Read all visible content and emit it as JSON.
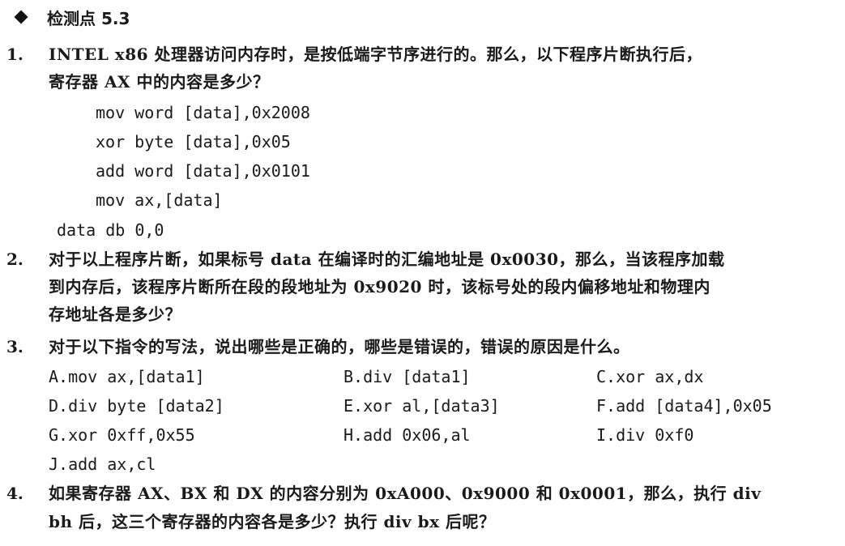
{
  "section": {
    "title": "检测点 5.3"
  },
  "questions": [
    {
      "number": "1.",
      "lines": [
        "INTEL x86 处理器访问内存时，是按低端字节序进行的。那么，以下程序片断执行后，",
        "寄存器 AX 中的内容是多少？"
      ],
      "code": [
        "mov word [data],0x2008",
        "xor byte [data],0x05",
        "add word [data],0x0101",
        "mov ax,[data]"
      ],
      "code_data_line": "data db 0,0"
    },
    {
      "number": "2.",
      "lines": [
        "对于以上程序片断，如果标号 data 在编译时的汇编地址是 0x0030，那么，当该程序加载",
        "到内存后，该程序片断所在段的段地址为 0x9020 时，该标号处的段内偏移地址和物理内",
        "存地址各是多少？"
      ]
    },
    {
      "number": "3.",
      "lines": [
        "对于以下指令的写法，说出哪些是正确的，哪些是错误的，错误的原因是什么。"
      ],
      "options": [
        "A.mov ax,[data1]",
        "B.div [data1]",
        "C.xor ax,dx",
        "D.div byte [data2]",
        "E.xor al,[data3]",
        "F.add [data4],0x05",
        "G.xor 0xff,0x55",
        "H.add 0x06,al",
        "I.div 0xf0",
        "J.add ax,cl"
      ]
    },
    {
      "number": "4.",
      "lines": [
        "如果寄存器 AX、BX 和 DX 的内容分别为 0xA000、0x9000 和 0x0001，那么，执行 div",
        "bh 后，这三个寄存器的内容各是多少？执行 div bx 后呢？"
      ]
    }
  ]
}
